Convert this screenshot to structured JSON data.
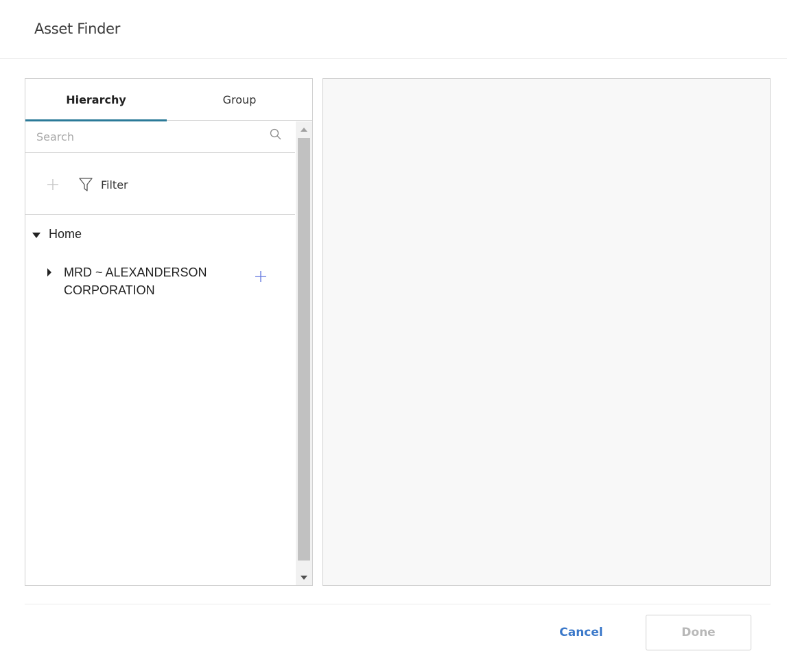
{
  "dialog": {
    "title": "Asset Finder"
  },
  "left_panel": {
    "tabs": [
      {
        "label": "Hierarchy",
        "active": true
      },
      {
        "label": "Group",
        "active": false
      }
    ],
    "search": {
      "placeholder": "Search",
      "value": "",
      "icon": "search-icon"
    },
    "toolbar": {
      "add_icon": "plus-icon",
      "filter_label": "Filter",
      "filter_icon": "filter-funnel-icon"
    },
    "tree": {
      "root": {
        "label": "Home",
        "expanded": true
      },
      "children": [
        {
          "label": "MRD ~ ALEXANDERSON CORPORATION",
          "expanded": false,
          "add_icon": "plus-icon"
        }
      ]
    }
  },
  "colors": {
    "active_tab_underline": "#2b7a98",
    "primary_link": "#3a78c9",
    "add_icon_accent": "#6b7fe0",
    "disabled_text": "#b8b8b8"
  },
  "footer": {
    "cancel_label": "Cancel",
    "done_label": "Done",
    "done_disabled": true
  }
}
